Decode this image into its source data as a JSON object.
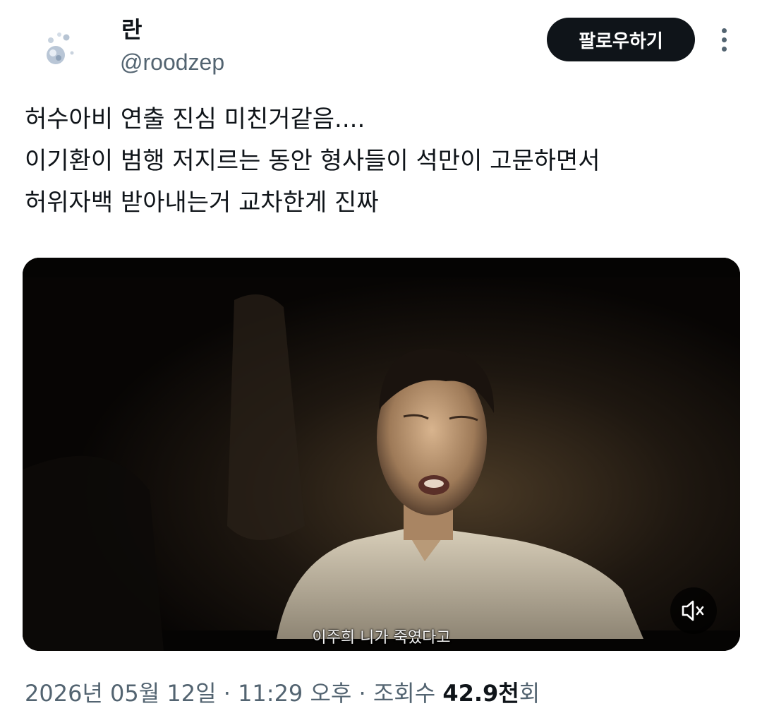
{
  "user": {
    "display_name": "란",
    "handle": "@roodzep"
  },
  "actions": {
    "follow_label": "팔로우하기",
    "more_icon": "more-vertical-icon"
  },
  "tweet": {
    "lines": [
      "허수아비 연출 진심 미친거같음....",
      "이기환이 범행 저지르는 동안 형사들이 석만이 고문하면서",
      "허위자백 받아내는거 교차한게 진짜"
    ]
  },
  "media": {
    "subtitle": "이주희 니가 죽였다고",
    "mute_icon": "volume-muted-icon"
  },
  "meta": {
    "date": "2026년 05월 12일",
    "separator": " · ",
    "time": "11:29 오후",
    "views_label": "조회수",
    "views_value": "42.9천",
    "views_suffix": "회"
  },
  "colors": {
    "text_primary": "#0f1419",
    "text_secondary": "#536471",
    "button_bg": "#0f1419",
    "button_text": "#ffffff"
  }
}
